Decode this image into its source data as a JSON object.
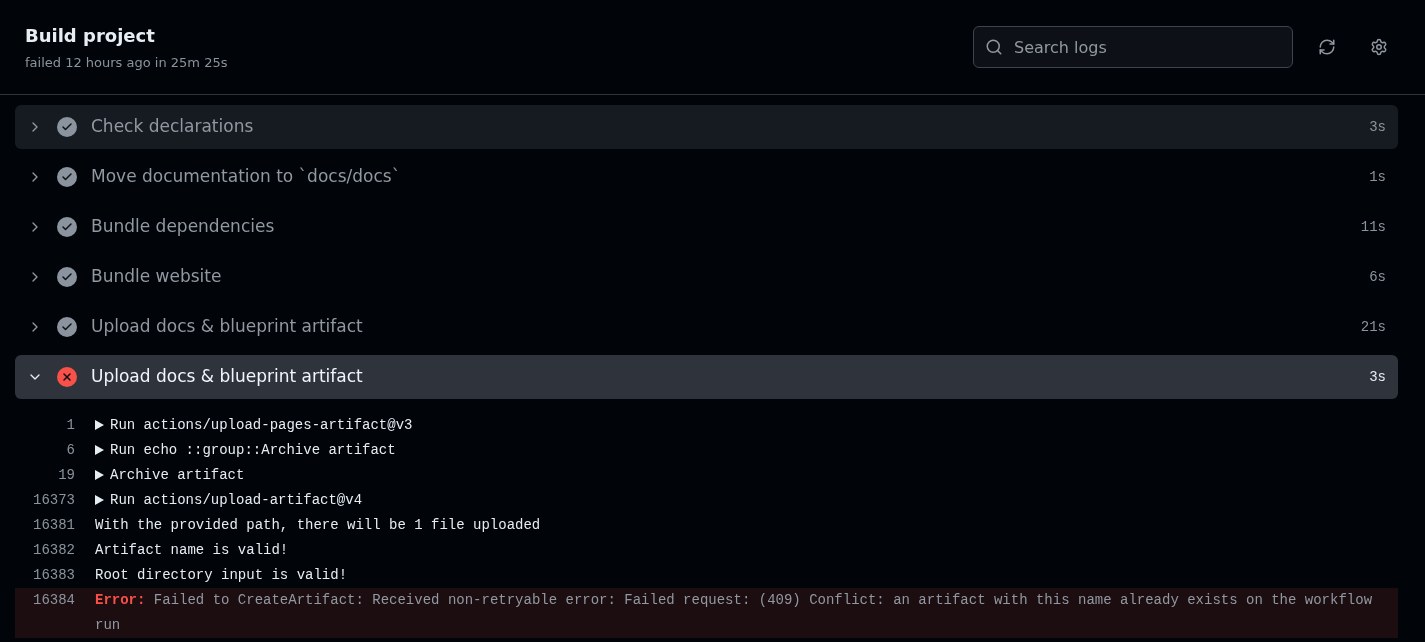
{
  "header": {
    "title": "Build project",
    "subtitle": "failed 12 hours ago in 25m 25s",
    "search": {
      "placeholder": "Search logs"
    }
  },
  "steps": [
    {
      "name": "Check declarations",
      "duration": "3s",
      "succeeded": true,
      "expanded": false,
      "highlighted": true
    },
    {
      "name": "Move documentation to `docs/docs`",
      "duration": "1s",
      "succeeded": true,
      "expanded": false,
      "highlighted": false
    },
    {
      "name": "Bundle dependencies",
      "duration": "11s",
      "succeeded": true,
      "expanded": false,
      "highlighted": false
    },
    {
      "name": "Bundle website",
      "duration": "6s",
      "succeeded": true,
      "expanded": false,
      "highlighted": false
    },
    {
      "name": "Upload docs & blueprint artifact",
      "duration": "21s",
      "succeeded": true,
      "expanded": false,
      "highlighted": false
    },
    {
      "name": "Upload docs & blueprint artifact",
      "duration": "3s",
      "succeeded": false,
      "expanded": true,
      "highlighted": false
    }
  ],
  "log": [
    {
      "number": "1",
      "kind": "group",
      "text": "Run actions/upload-pages-artifact@v3"
    },
    {
      "number": "6",
      "kind": "group",
      "text": "Run echo ::group::Archive artifact"
    },
    {
      "number": "19",
      "kind": "group",
      "text": "Archive artifact"
    },
    {
      "number": "16373",
      "kind": "group",
      "text": "Run actions/upload-artifact@v4"
    },
    {
      "number": "16381",
      "kind": "plain",
      "text": "With the provided path, there will be 1 file uploaded"
    },
    {
      "number": "16382",
      "kind": "plain",
      "text": "Artifact name is valid!"
    },
    {
      "number": "16383",
      "kind": "plain",
      "text": "Root directory input is valid!"
    },
    {
      "number": "16384",
      "kind": "error",
      "label": "Error:",
      "text": "Failed to CreateArtifact: Received non-retryable error: Failed request: (409) Conflict: an artifact with this name already exists on the workflow run"
    }
  ]
}
